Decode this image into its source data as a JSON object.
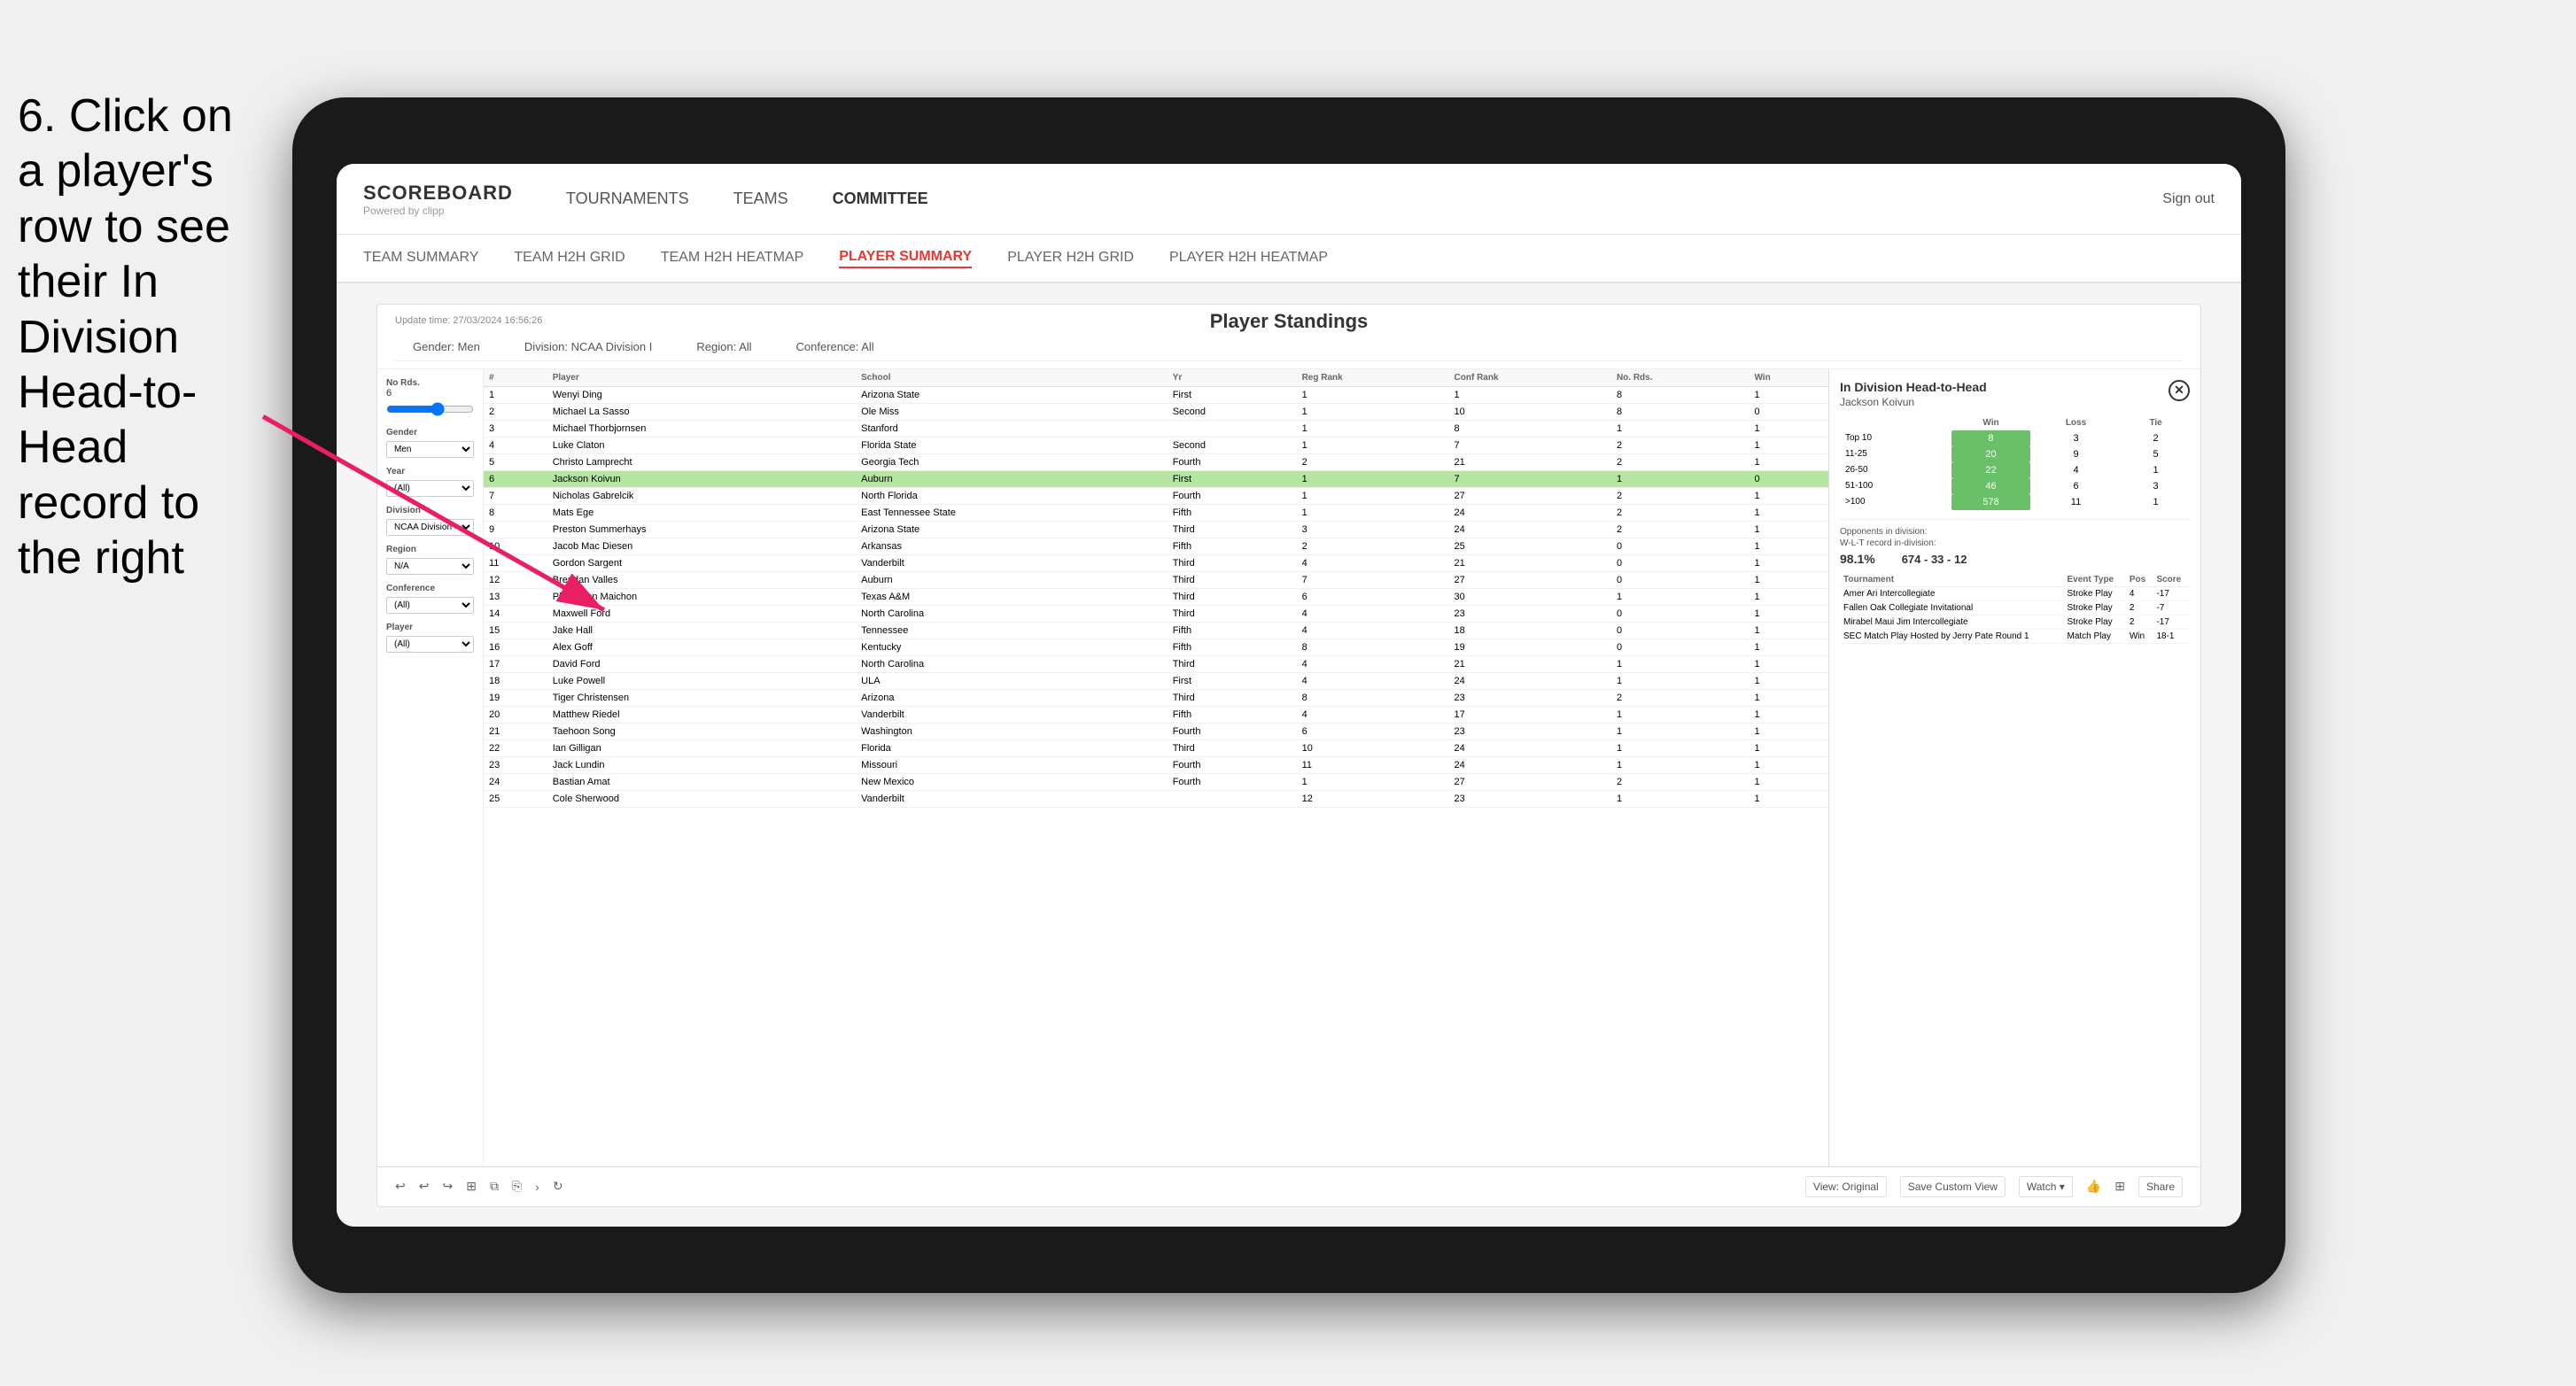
{
  "instruction": {
    "text": "6. Click on a player's row to see their In Division Head-to-Head record to the right"
  },
  "nav": {
    "logo": "SCOREBOARD",
    "logo_sub": "Powered by clipp",
    "items": [
      "TOURNAMENTS",
      "TEAMS",
      "COMMITTEE"
    ],
    "sign_out": "Sign out"
  },
  "sub_nav": {
    "items": [
      "TEAM SUMMARY",
      "TEAM H2H GRID",
      "TEAM H2H HEATMAP",
      "PLAYER SUMMARY",
      "PLAYER H2H GRID",
      "PLAYER H2H HEATMAP"
    ],
    "active": "PLAYER SUMMARY"
  },
  "panel": {
    "update_time": "Update time: 27/03/2024 16:56:26",
    "title": "Player Standings",
    "filters": {
      "gender": "Gender: Men",
      "division": "Division: NCAA Division I",
      "region": "Region: All",
      "conference": "Conference: All"
    }
  },
  "sidebar": {
    "no_rds_label": "No Rds.",
    "no_rds_value": "6",
    "gender_label": "Gender",
    "gender_value": "Men",
    "year_label": "Year",
    "year_value": "(All)",
    "division_label": "Division",
    "division_value": "NCAA Division I",
    "region_label": "Region",
    "region_value": "N/A",
    "conference_label": "Conference",
    "conference_value": "(All)",
    "player_label": "Player",
    "player_value": "(All)"
  },
  "table": {
    "headers": [
      "#",
      "Player",
      "School",
      "Yr",
      "Reg Rank",
      "Conf Rank",
      "No. Rds.",
      "Win"
    ],
    "rows": [
      {
        "num": 1,
        "player": "Wenyi Ding",
        "school": "Arizona State",
        "yr": "First",
        "reg": 1,
        "conf": 1,
        "rds": 8,
        "win": 1,
        "highlighted": false
      },
      {
        "num": 2,
        "player": "Michael La Sasso",
        "school": "Ole Miss",
        "yr": "Second",
        "reg": 1,
        "conf": 10,
        "rds": 8,
        "win": 0,
        "highlighted": false
      },
      {
        "num": 3,
        "player": "Michael Thorbjornsen",
        "school": "Stanford",
        "yr": "",
        "reg": 1,
        "conf": 8,
        "rds": 1,
        "win": 1,
        "highlighted": false
      },
      {
        "num": 4,
        "player": "Luke Claton",
        "school": "Florida State",
        "yr": "Second",
        "reg": 1,
        "conf": 7,
        "rds": 2,
        "win": 1,
        "highlighted": false
      },
      {
        "num": 5,
        "player": "Christo Lamprecht",
        "school": "Georgia Tech",
        "yr": "Fourth",
        "reg": 2,
        "conf": 21,
        "rds": 2,
        "win": 1,
        "highlighted": false
      },
      {
        "num": 6,
        "player": "Jackson Koivun",
        "school": "Auburn",
        "yr": "First",
        "reg": 1,
        "conf": 7,
        "rds": 1,
        "win": 0,
        "highlighted": true
      },
      {
        "num": 7,
        "player": "Nicholas Gabrelcik",
        "school": "North Florida",
        "yr": "Fourth",
        "reg": 1,
        "conf": 27,
        "rds": 2,
        "win": 1,
        "highlighted": false
      },
      {
        "num": 8,
        "player": "Mats Ege",
        "school": "East Tennessee State",
        "yr": "Fifth",
        "reg": 1,
        "conf": 24,
        "rds": 2,
        "win": 1,
        "highlighted": false
      },
      {
        "num": 9,
        "player": "Preston Summerhays",
        "school": "Arizona State",
        "yr": "Third",
        "reg": 3,
        "conf": 24,
        "rds": 2,
        "win": 1,
        "highlighted": false
      },
      {
        "num": 10,
        "player": "Jacob Mac Diesen",
        "school": "Arkansas",
        "yr": "Fifth",
        "reg": 2,
        "conf": 25,
        "rds": 0,
        "win": 1,
        "highlighted": false
      },
      {
        "num": 11,
        "player": "Gordon Sargent",
        "school": "Vanderbilt",
        "yr": "Third",
        "reg": 4,
        "conf": 21,
        "rds": 0,
        "win": 1,
        "highlighted": false
      },
      {
        "num": 12,
        "player": "Brendan Valles",
        "school": "Auburn",
        "yr": "Third",
        "reg": 7,
        "conf": 27,
        "rds": 0,
        "win": 1,
        "highlighted": false
      },
      {
        "num": 13,
        "player": "Phichaksn Maichon",
        "school": "Texas A&M",
        "yr": "Third",
        "reg": 6,
        "conf": 30,
        "rds": 1,
        "win": 1,
        "highlighted": false
      },
      {
        "num": 14,
        "player": "Maxwell Ford",
        "school": "North Carolina",
        "yr": "Third",
        "reg": 4,
        "conf": 23,
        "rds": 0,
        "win": 1,
        "highlighted": false
      },
      {
        "num": 15,
        "player": "Jake Hall",
        "school": "Tennessee",
        "yr": "Fifth",
        "reg": 4,
        "conf": 18,
        "rds": 0,
        "win": 1,
        "highlighted": false
      },
      {
        "num": 16,
        "player": "Alex Goff",
        "school": "Kentucky",
        "yr": "Fifth",
        "reg": 8,
        "conf": 19,
        "rds": 0,
        "win": 1,
        "highlighted": false
      },
      {
        "num": 17,
        "player": "David Ford",
        "school": "North Carolina",
        "yr": "Third",
        "reg": 4,
        "conf": 21,
        "rds": 1,
        "win": 1,
        "highlighted": false
      },
      {
        "num": 18,
        "player": "Luke Powell",
        "school": "ULA",
        "yr": "First",
        "reg": 4,
        "conf": 24,
        "rds": 1,
        "win": 1,
        "highlighted": false
      },
      {
        "num": 19,
        "player": "Tiger Christensen",
        "school": "Arizona",
        "yr": "Third",
        "reg": 8,
        "conf": 23,
        "rds": 2,
        "win": 1,
        "highlighted": false
      },
      {
        "num": 20,
        "player": "Matthew Riedel",
        "school": "Vanderbilt",
        "yr": "Fifth",
        "reg": 4,
        "conf": 17,
        "rds": 1,
        "win": 1,
        "highlighted": false
      },
      {
        "num": 21,
        "player": "Taehoon Song",
        "school": "Washington",
        "yr": "Fourth",
        "reg": 6,
        "conf": 23,
        "rds": 1,
        "win": 1,
        "highlighted": false
      },
      {
        "num": 22,
        "player": "Ian Gilligan",
        "school": "Florida",
        "yr": "Third",
        "reg": 10,
        "conf": 24,
        "rds": 1,
        "win": 1,
        "highlighted": false
      },
      {
        "num": 23,
        "player": "Jack Lundin",
        "school": "Missouri",
        "yr": "Fourth",
        "reg": 11,
        "conf": 24,
        "rds": 1,
        "win": 1,
        "highlighted": false
      },
      {
        "num": 24,
        "player": "Bastian Amat",
        "school": "New Mexico",
        "yr": "Fourth",
        "reg": 1,
        "conf": 27,
        "rds": 2,
        "win": 1,
        "highlighted": false
      },
      {
        "num": 25,
        "player": "Cole Sherwood",
        "school": "Vanderbilt",
        "yr": "",
        "reg": 12,
        "conf": 23,
        "rds": 1,
        "win": 1,
        "highlighted": false
      }
    ]
  },
  "h2h": {
    "title": "In Division Head-to-Head",
    "player": "Jackson Koivun",
    "close_btn": "✕",
    "table_headers": [
      "",
      "Win",
      "Loss",
      "Tie"
    ],
    "rows": [
      {
        "label": "Top 10",
        "win": 8,
        "loss": 3,
        "tie": 2
      },
      {
        "label": "11-25",
        "win": 20,
        "loss": 9,
        "tie": 5
      },
      {
        "label": "26-50",
        "win": 22,
        "loss": 4,
        "tie": 1
      },
      {
        "label": "51-100",
        "win": 46,
        "loss": 6,
        "tie": 3
      },
      {
        "label": ">100",
        "win": 578,
        "loss": 11,
        "tie": 1
      }
    ],
    "opponents_label": "Opponents in division:",
    "opponents_wlt_label": "W-L-T record in-division:",
    "opponents_pct": "98.1%",
    "wlt": "674 - 33 - 12",
    "tournament_headers": [
      "Tournament",
      "Event Type",
      "Pos",
      "Score"
    ],
    "tournaments": [
      {
        "name": "Amer Ari Intercollegiate",
        "type": "Stroke Play",
        "pos": 4,
        "score": "-17"
      },
      {
        "name": "Fallen Oak Collegiate Invitational",
        "type": "Stroke Play",
        "pos": 2,
        "score": "-7"
      },
      {
        "name": "Mirabel Maui Jim Intercollegiate",
        "type": "Stroke Play",
        "pos": 2,
        "score": "-17"
      },
      {
        "name": "SEC Match Play Hosted by Jerry Pate Round 1",
        "type": "Match Play",
        "pos": "Win",
        "score": "18-1"
      }
    ]
  },
  "toolbar": {
    "undo": "↩",
    "redo": "↪",
    "forward": "→",
    "view_original": "View: Original",
    "save_custom": "Save Custom View",
    "watch": "Watch ▾",
    "share": "Share"
  }
}
